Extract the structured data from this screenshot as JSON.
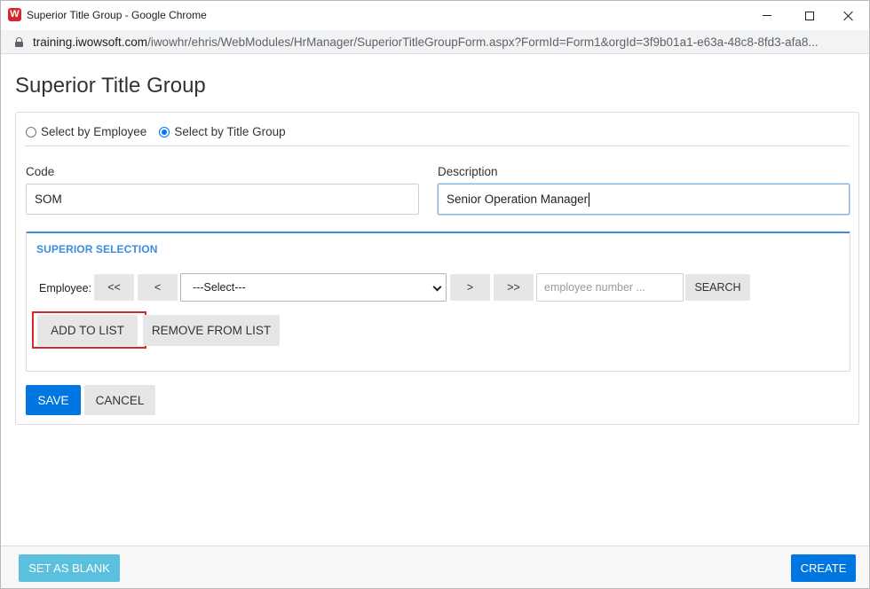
{
  "window": {
    "app_icon": "W",
    "title": "Superior Title Group - Google Chrome"
  },
  "address_bar": {
    "host": "training.iwowsoft.com",
    "path": "/iwowhr/ehris/WebModules/HrManager/SuperiorTitleGroupForm.aspx?FormId=Form1&orgId=3f9b01a1-e63a-48c8-8fd3-afa8..."
  },
  "page": {
    "title": "Superior Title Group"
  },
  "selection_mode": {
    "options": [
      {
        "label": "Select by Employee",
        "checked": false
      },
      {
        "label": "Select by Title Group",
        "checked": true
      }
    ]
  },
  "form": {
    "code_label": "Code",
    "code_value": "SOM",
    "description_label": "Description",
    "description_value": "Senior Operation Manager"
  },
  "superior_selection": {
    "title": "SUPERIOR SELECTION",
    "employee_label": "Employee:",
    "first_label": "<<",
    "prev_label": "<",
    "select_value": "---Select---",
    "next_label": ">",
    "last_label": ">>",
    "search_placeholder": "employee number ...",
    "search_label": "SEARCH",
    "add_label": "ADD TO LIST",
    "remove_label": "REMOVE FROM LIST"
  },
  "actions": {
    "save_label": "SAVE",
    "cancel_label": "CANCEL"
  },
  "footer": {
    "set_blank_label": "SET AS BLANK",
    "create_label": "CREATE"
  },
  "colors": {
    "primary": "#0076e0",
    "info": "#5bc0de",
    "section_title": "#3c8dde",
    "highlight": "#d9262c"
  }
}
